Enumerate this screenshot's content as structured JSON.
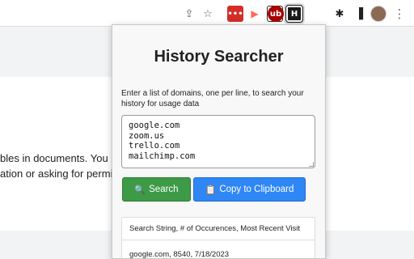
{
  "browser": {
    "toolbar_icons": [
      {
        "name": "share-icon",
        "glyph": "⇪"
      },
      {
        "name": "star-icon",
        "glyph": "☆"
      }
    ],
    "extensions": [
      {
        "name": "lastpass-extension-icon",
        "glyph": "•••",
        "color": "#d32d27"
      },
      {
        "name": "screencast-extension-icon",
        "glyph": "▶",
        "color": "#ff6b5b"
      },
      {
        "name": "tab-extension-icon",
        "glyph": "t.",
        "color": "#2b2b2b"
      },
      {
        "name": "ublock-extension-icon",
        "glyph": "ub",
        "color": "#a80000"
      },
      {
        "name": "history-searcher-extension-icon",
        "glyph": "H",
        "color": "#1a1a1a"
      },
      {
        "name": "puzzle-icon",
        "glyph": "✱",
        "color": "#5f6368"
      },
      {
        "name": "sidepanel-icon",
        "glyph": "▐",
        "color": "#202124"
      },
      {
        "name": "kebab-menu-icon",
        "glyph": "⋮",
        "color": "#5f6368"
      }
    ]
  },
  "page": {
    "line1": "bles in documents. You n",
    "line2": "ation or asking for permis"
  },
  "popup": {
    "title": "History Searcher",
    "instructions": "Enter a list of domains, one per line, to search your history for usage data",
    "domains_text": "google.com\nzoom.us\ntrello.com\nmailchimp.com",
    "search_button": {
      "icon": "🔍",
      "label": "Search"
    },
    "copy_button": {
      "icon": "📋",
      "label": "Copy to Clipboard"
    },
    "results": {
      "header": "Search String, # of Occurences, Most Recent Visit",
      "rows": [
        "google.com, 8540, 7/18/2023"
      ]
    }
  },
  "colors": {
    "search_button": "#3d9a46",
    "copy_button": "#2f86f5"
  }
}
